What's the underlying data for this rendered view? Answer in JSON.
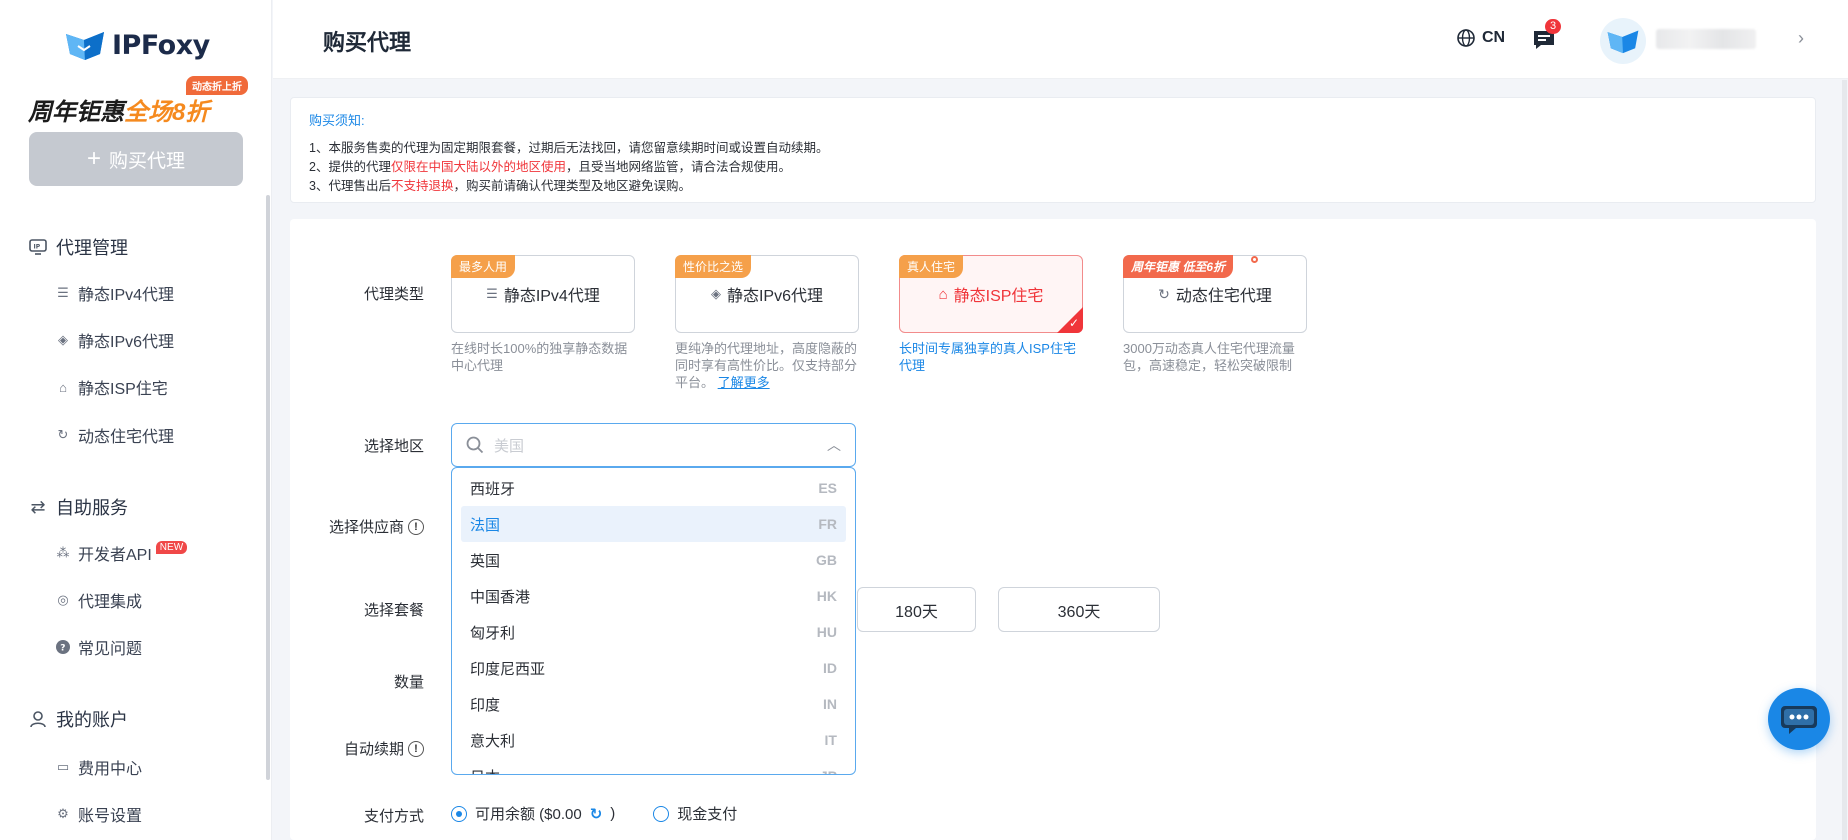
{
  "brand": {
    "name": "IPFoxy"
  },
  "promo": {
    "tag": "动态折上折",
    "text_black": "周年钜惠",
    "text_orange": "全场8折"
  },
  "sidebar": {
    "buy_button": "购买代理",
    "sections": [
      {
        "label": "代理管理",
        "items": [
          "静态IPv4代理",
          "静态IPv6代理",
          "静态ISP住宅",
          "动态住宅代理"
        ]
      },
      {
        "label": "自助服务",
        "items": [
          "开发者API",
          "代理集成",
          "常见问题"
        ],
        "badge": "NEW"
      },
      {
        "label": "我的账户",
        "items": [
          "费用中心",
          "账号设置"
        ]
      }
    ]
  },
  "header": {
    "title": "购买代理",
    "lang": "CN",
    "msg_count": "3"
  },
  "notice": {
    "title": "购买须知:",
    "line1": "1、本服务售卖的代理为固定期限套餐，过期后无法找回，请您留意续期时间或设置自动续期。",
    "line2_a": "2、提供的代理",
    "line2_red": "仅限在中国大陆以外的地区使用",
    "line2_b": "，且受当地网络监管，请合法合规使用。",
    "line3_a": "3、代理售出后",
    "line3_red": "不支持退换",
    "line3_b": "，购买前请确认代理类型及地区避免误购。"
  },
  "form": {
    "labels": {
      "type": "代理类型",
      "region": "选择地区",
      "supplier": "选择供应商",
      "plan": "选择套餐",
      "qty": "数量",
      "renew": "自动续期",
      "pay": "支付方式"
    },
    "types": [
      {
        "tag": "最多人用",
        "label": "静态IPv4代理",
        "desc": "在线时长100%的独享静态数据中心代理"
      },
      {
        "tag": "性价比之选",
        "label": "静态IPv6代理",
        "desc": "更纯净的代理地址，高度隐蔽的同时享有高性价比。仅支持部分平台。",
        "link": "了解更多"
      },
      {
        "tag": "真人住宅",
        "label": "静态ISP住宅",
        "desc": "长时间专属独享的真人ISP住宅代理"
      },
      {
        "tag": "周年钜惠 低至6折",
        "label": "动态住宅代理",
        "desc": "3000万动态真人住宅代理流量包，高速稳定，轻松突破限制"
      }
    ],
    "region_placeholder": "美国",
    "regions": [
      {
        "name": "西班牙",
        "code": "ES"
      },
      {
        "name": "法国",
        "code": "FR"
      },
      {
        "name": "英国",
        "code": "GB"
      },
      {
        "name": "中国香港",
        "code": "HK"
      },
      {
        "name": "匈牙利",
        "code": "HU"
      },
      {
        "name": "印度尼西亚",
        "code": "ID"
      },
      {
        "name": "印度",
        "code": "IN"
      },
      {
        "name": "意大利",
        "code": "IT"
      },
      {
        "name": "日本",
        "code": "JP"
      }
    ],
    "plans": [
      "180天",
      "360天"
    ],
    "pay": {
      "balance": "可用余额 ($0.00",
      "balance_close": ")",
      "cash": "现金支付"
    }
  }
}
